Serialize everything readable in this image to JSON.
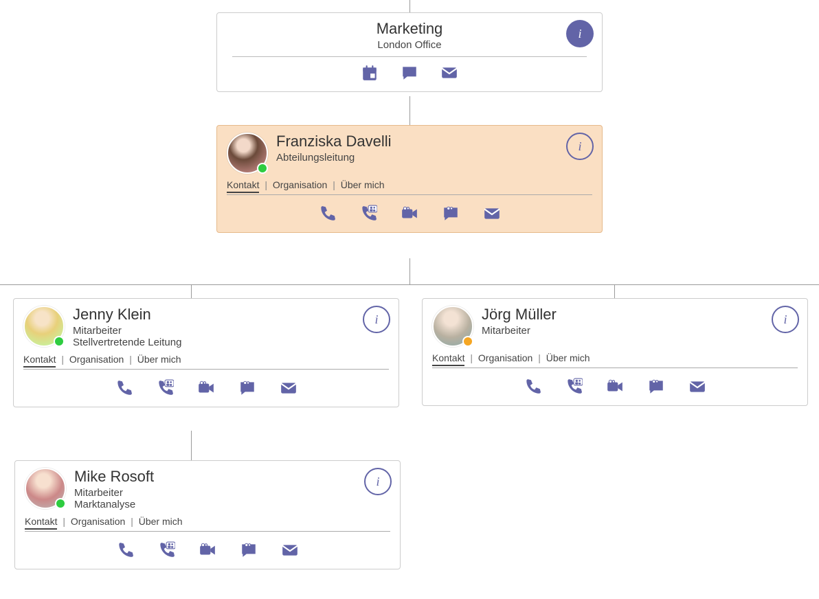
{
  "department": {
    "title": "Marketing",
    "subtitle": "London Office"
  },
  "tabs": {
    "contact": "Kontakt",
    "organization": "Organisation",
    "about": "Über mich"
  },
  "people": {
    "franziska": {
      "name": "Franziska Davelli",
      "role": "Abteilungsleitung",
      "presence": "available"
    },
    "jenny": {
      "name": "Jenny Klein",
      "role": "Mitarbeiter",
      "extra": "Stellvertretende Leitung",
      "presence": "available"
    },
    "joerg": {
      "name": "Jörg Müller",
      "role": "Mitarbeiter",
      "presence": "away"
    },
    "mike": {
      "name": "Mike Rosoft",
      "role": "Mitarbeiter",
      "extra": "Marktanalyse",
      "presence": "available"
    }
  },
  "icons": {
    "info": "i"
  }
}
